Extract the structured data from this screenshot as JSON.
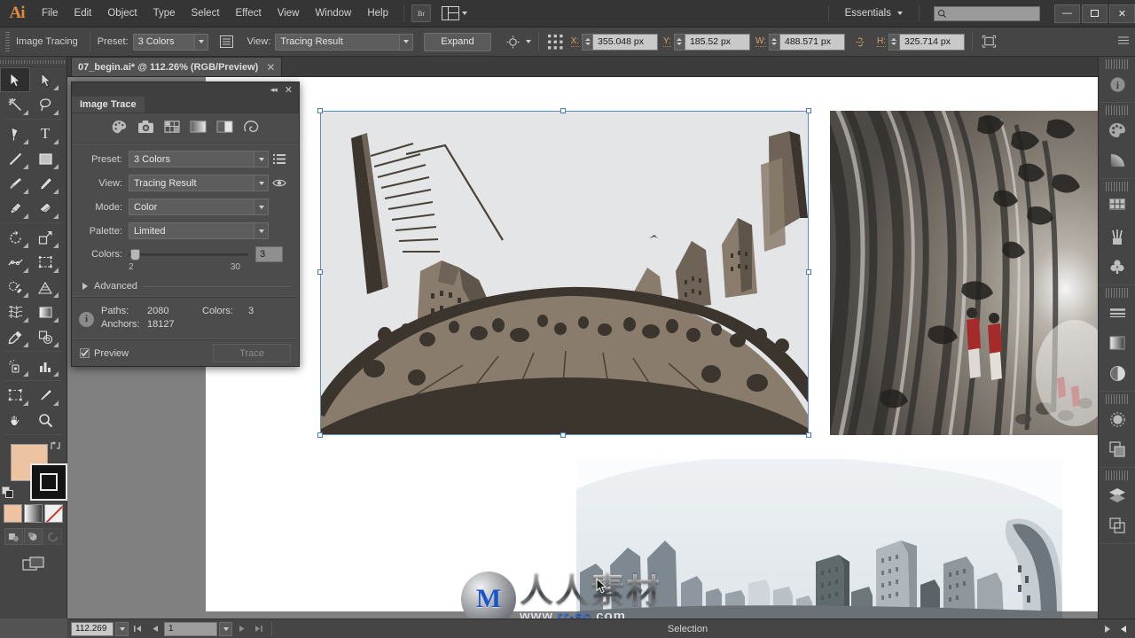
{
  "app": {
    "name": "Adobe Illustrator",
    "logo": "Ai"
  },
  "menubar": {
    "items": [
      "File",
      "Edit",
      "Object",
      "Type",
      "Select",
      "Effect",
      "View",
      "Window",
      "Help"
    ],
    "bridge_label": "Br",
    "arrange_icon": "arrange-documents-icon",
    "workspace": "Essentials",
    "search_placeholder": "",
    "search_value": "",
    "window_controls": {
      "minimize": "—",
      "maximize": "❐",
      "close": "✕"
    }
  },
  "controlbar": {
    "title": "Image Tracing",
    "preset_label": "Preset:",
    "preset_value": "3 Colors",
    "panel_icon": "trace-options-icon",
    "view_label": "View:",
    "view_value": "Tracing Result",
    "expand_label": "Expand",
    "isolate_icon": "isolate-selection-icon",
    "align_icon": "align-transform-icon",
    "fields": [
      {
        "label": "X:",
        "value": "355.048 px",
        "name": "x-position-field"
      },
      {
        "label": "Y:",
        "value": "185.52 px",
        "name": "y-position-field"
      },
      {
        "label": "W:",
        "value": "488.571 px",
        "name": "width-field"
      },
      {
        "label": "H:",
        "value": "325.714 px",
        "name": "height-field"
      }
    ],
    "lock_icon": "constrain-proportions-icon",
    "transform_icon": "transform-again-icon"
  },
  "document": {
    "tab_title": "07_begin.ai* @ 112.26% (RGB/Preview)",
    "close_glyph": "✕"
  },
  "toolbar": {
    "tools": [
      {
        "name": "selection-tool",
        "glyph": "⬈",
        "selected": true
      },
      {
        "name": "direct-selection-tool",
        "glyph": "➤",
        "selected": false
      },
      {
        "name": "magic-wand-tool",
        "glyph": "✦",
        "selected": false
      },
      {
        "name": "lasso-tool",
        "glyph": "❦",
        "selected": false
      },
      {
        "name": "pen-tool",
        "glyph": "✒",
        "selected": false
      },
      {
        "name": "type-tool",
        "glyph": "T",
        "selected": false
      },
      {
        "name": "line-segment-tool",
        "glyph": "╱",
        "selected": false
      },
      {
        "name": "rectangle-tool",
        "glyph": "■",
        "selected": false
      },
      {
        "name": "paintbrush-tool",
        "glyph": "✎",
        "selected": false
      },
      {
        "name": "pencil-tool",
        "glyph": "✏",
        "selected": false
      },
      {
        "name": "blob-brush-tool",
        "glyph": "✒",
        "selected": false
      },
      {
        "name": "eraser-tool",
        "glyph": "▱",
        "selected": false
      },
      {
        "name": "rotate-tool",
        "glyph": "↻",
        "selected": false
      },
      {
        "name": "scale-tool",
        "glyph": "⤢",
        "selected": false
      },
      {
        "name": "width-tool",
        "glyph": "∴",
        "selected": false
      },
      {
        "name": "free-transform-tool",
        "glyph": "⬚",
        "selected": false
      },
      {
        "name": "shape-builder-tool",
        "glyph": "◔",
        "selected": false
      },
      {
        "name": "perspective-grid-tool",
        "glyph": "◧",
        "selected": false
      },
      {
        "name": "mesh-tool",
        "glyph": "⌧",
        "selected": false
      },
      {
        "name": "gradient-tool",
        "glyph": "▤",
        "selected": false
      },
      {
        "name": "eyedropper-tool",
        "glyph": "⚗",
        "selected": false
      },
      {
        "name": "blend-tool",
        "glyph": "◎",
        "selected": false
      },
      {
        "name": "symbol-sprayer-tool",
        "glyph": "☂",
        "selected": false
      },
      {
        "name": "column-graph-tool",
        "glyph": "☷",
        "selected": false
      },
      {
        "name": "artboard-tool",
        "glyph": "⬚",
        "selected": false
      },
      {
        "name": "slice-tool",
        "glyph": "✁",
        "selected": false
      },
      {
        "name": "hand-tool",
        "glyph": "✋",
        "selected": false
      },
      {
        "name": "zoom-tool",
        "glyph": "⌕",
        "selected": false
      }
    ],
    "fill_color": "#eec3a2",
    "stroke_color": "#141414",
    "swap_icon": "swap-fill-stroke-icon",
    "default_icon": "default-fill-stroke-icon",
    "mode_swatches": [
      "color-fill-mode",
      "gradient-fill-mode",
      "none-fill-mode"
    ],
    "draw_modes": [
      "draw-normal",
      "draw-behind",
      "draw-inside"
    ],
    "screen_mode_icon": "change-screen-mode-icon"
  },
  "image_trace_panel": {
    "title": "Image Trace",
    "collapse_glyph": "◂◂",
    "close_glyph": "✕",
    "preset_icons": [
      "auto-color-icon",
      "high-color-photo-icon",
      "low-color-icon",
      "grayscale-icon",
      "black-and-white-icon",
      "outline-icon"
    ],
    "rows": [
      {
        "label": "Preset:",
        "value": "3 Colors",
        "name": "preset-dropdown"
      },
      {
        "label": "View:",
        "value": "Tracing Result",
        "name": "view-dropdown"
      },
      {
        "label": "Mode:",
        "value": "Color",
        "name": "mode-dropdown"
      },
      {
        "label": "Palette:",
        "value": "Limited",
        "name": "palette-dropdown"
      }
    ],
    "menu_icon": "panel-menu-icon",
    "eye_icon": "preview-eye-icon",
    "colors_label": "Colors:",
    "colors_value": "3",
    "colors_min": "2",
    "colors_max": "30",
    "advanced_label": "Advanced",
    "info": {
      "paths_label": "Paths:",
      "paths_value": "2080",
      "anchors_label": "Anchors:",
      "anchors_value": "18127",
      "colors_label": "Colors:",
      "colors_value": "3"
    },
    "preview_label": "Preview",
    "preview_checked": true,
    "trace_label": "Trace",
    "trace_enabled": false
  },
  "statusbar": {
    "zoom_value": "112.269",
    "page_value": "1",
    "status_text": "Selection",
    "first_glyph": "⏮",
    "prev_glyph": "◀",
    "next_glyph": "▶",
    "last_glyph": "⏭"
  },
  "right_dock": {
    "groups": [
      {
        "items": [
          {
            "name": "info-panel-icon",
            "glyph": "i"
          }
        ]
      },
      {
        "items": [
          {
            "name": "color-panel-icon",
            "glyph": "⚘"
          },
          {
            "name": "color-guide-panel-icon",
            "glyph": "◴"
          }
        ]
      },
      {
        "items": [
          {
            "name": "swatches-panel-icon",
            "glyph": "⊞"
          },
          {
            "name": "brushes-panel-icon",
            "glyph": "✒"
          },
          {
            "name": "symbols-panel-icon",
            "glyph": "♣"
          }
        ]
      },
      {
        "items": [
          {
            "name": "stroke-panel-icon",
            "glyph": "☰"
          },
          {
            "name": "gradient-panel-icon",
            "glyph": "▤"
          },
          {
            "name": "transparency-panel-icon",
            "glyph": "◑"
          }
        ]
      },
      {
        "items": [
          {
            "name": "appearance-panel-icon",
            "glyph": "●"
          },
          {
            "name": "graphic-styles-panel-icon",
            "glyph": "⧉"
          }
        ]
      },
      {
        "items": [
          {
            "name": "layers-panel-icon",
            "glyph": "⬟"
          },
          {
            "name": "artboards-panel-icon",
            "glyph": "❐"
          }
        ]
      }
    ]
  },
  "artwork": {
    "traced_image": {
      "name": "traced-cloud-gate-artwork",
      "description": "Cloud Gate sculpture traced to 3 colors",
      "colors": {
        "sky": "#e3e5e7",
        "mid": "#8a7c6c",
        "dark": "#39332b"
      }
    },
    "photo_right": {
      "name": "cloud-gate-omphalos-photo",
      "accent": "#a52b2b"
    },
    "photo_bottom": {
      "name": "chicago-skyline-reflection-photo"
    }
  },
  "watermark": {
    "logo_letter": "M",
    "chinese": "人人素材",
    "url_prefix": "www.",
    "url_brand": "rr-sc",
    "url_suffix": ".com"
  }
}
